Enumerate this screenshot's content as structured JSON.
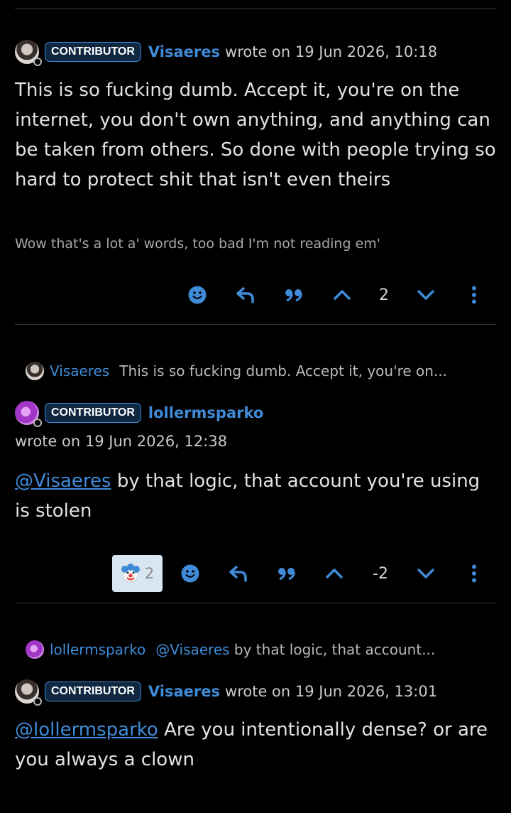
{
  "comments": [
    {
      "author": "Visaeres",
      "badge": "CONTRIBUTOR",
      "meta": "wrote on 19 Jun 2026, 10:18",
      "body": "This is so fucking dumb. Accept it, you're on the internet, you don't own anything, and anything can be taken from others. So done with people trying so hard to protect shit that isn't even theirs",
      "signature": "Wow that's a lot a' words, too bad I'm not reading em'",
      "vote_count": "2"
    },
    {
      "context_author": "Visaeres",
      "context_excerpt": "This is so fucking dumb. Accept it, you're on...",
      "author": "lollermsparko",
      "badge": "CONTRIBUTOR",
      "meta": "wrote on 19 Jun 2026, 12:38",
      "mention": "@Visaeres",
      "body": " by that logic, that account you're using is stolen",
      "reaction_count": "2",
      "vote_count": "-2"
    },
    {
      "context_author": "lollermsparko",
      "context_mention": "@Visaeres",
      "context_excerpt": " by that logic, that account...",
      "author": "Visaeres",
      "badge": "CONTRIBUTOR",
      "meta": "wrote on 19 Jun 2026, 13:01",
      "mention": "@lollermsparko",
      "body": " Are you intentionally dense? or are you always a clown"
    }
  ],
  "icons": {
    "emoji": "smile-icon",
    "reply": "reply-icon",
    "quote": "quote-icon",
    "upvote": "chevron-up-icon",
    "downvote": "chevron-down-icon",
    "more": "more-vertical-icon",
    "reaction": "clown-emoji-icon"
  },
  "colors": {
    "accent": "#3f8bd8",
    "background": "#000000",
    "badge_bg": "#0f2740",
    "reaction_bg": "#d8e6f2"
  }
}
